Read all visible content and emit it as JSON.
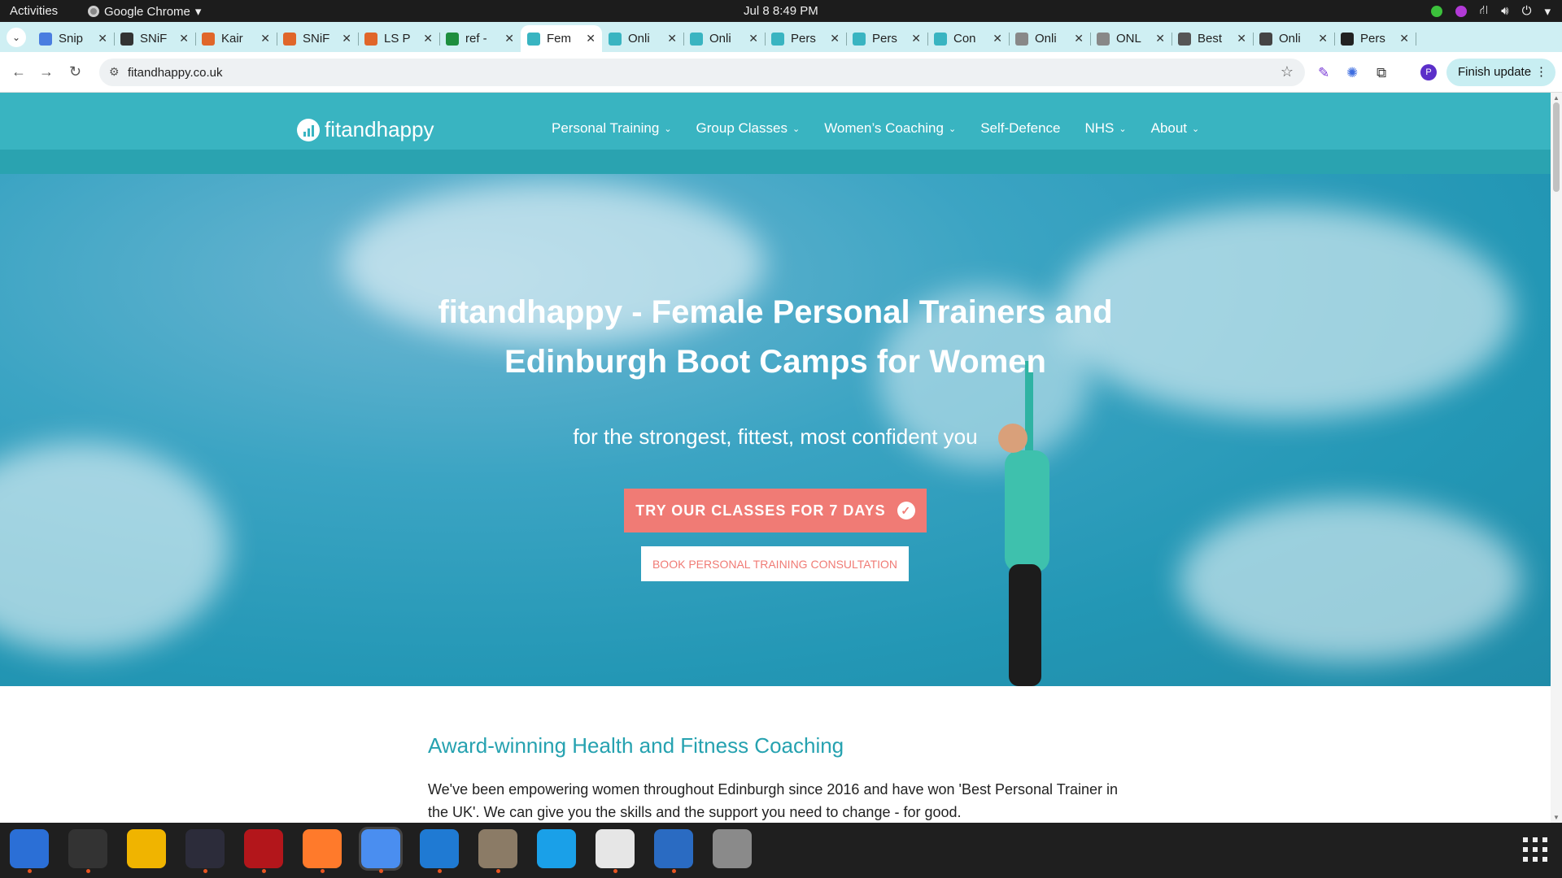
{
  "system_bar": {
    "activities": "Activities",
    "app_name": "Google Chrome",
    "clock": "Jul 8  8:49 PM"
  },
  "tabs": [
    {
      "title": "Snip",
      "color": "#4a7de0"
    },
    {
      "title": "SNiF",
      "color": "#333333"
    },
    {
      "title": "Kair",
      "color": "#e0662a"
    },
    {
      "title": "SNiF",
      "color": "#e0662a"
    },
    {
      "title": "LS P",
      "color": "#e0662a"
    },
    {
      "title": "ref -",
      "color": "#1e8e3e"
    },
    {
      "title": "Fem",
      "color": "#39b4c1"
    },
    {
      "title": "Onli",
      "color": "#39b4c1"
    },
    {
      "title": "Onli",
      "color": "#39b4c1"
    },
    {
      "title": "Pers",
      "color": "#39b4c1"
    },
    {
      "title": "Pers",
      "color": "#39b4c1"
    },
    {
      "title": "Con",
      "color": "#39b4c1"
    },
    {
      "title": "Onli",
      "color": "#888888"
    },
    {
      "title": "ONL",
      "color": "#888888"
    },
    {
      "title": "Best",
      "color": "#555555"
    },
    {
      "title": "Onli",
      "color": "#444444"
    },
    {
      "title": "Pers",
      "color": "#222222"
    }
  ],
  "browser": {
    "url": "fitandhappy.co.uk",
    "finish_update": "Finish update",
    "profile_initial": "P"
  },
  "site": {
    "logo_text": "fitandhappy",
    "nav": [
      "Personal Training",
      "Group Classes",
      "Women’s Coaching",
      "Self-Defence",
      "NHS",
      "About"
    ],
    "hero_title_line1": "fitandhappy - Female Personal Trainers and",
    "hero_title_line2": "Edinburgh Boot Camps for Women",
    "hero_subtitle": "for the strongest, fittest, most confident you",
    "cta_primary": "TRY OUR CLASSES FOR 7 DAYS",
    "cta_secondary": "BOOK PERSONAL TRAINING CONSULTATION",
    "section_title": "Award-winning Health and Fitness Coaching",
    "section_body": "We've been empowering women throughout Edinburgh since 2016 and have won 'Best Personal Trainer in the UK'. We can give you the skills and the support you need to change - for good."
  },
  "colors": {
    "brand_teal": "#39b4c1",
    "cta_coral": "#f07b75"
  },
  "dock": [
    "thunderbird-icon",
    "terminal-icon",
    "calculator-icon",
    "system-monitor-icon",
    "filezilla-icon",
    "firefox-icon",
    "chrome-icon",
    "vscode-icon",
    "files-icon",
    "skype-icon",
    "text-editor-icon",
    "writer-icon",
    "disk-icon"
  ]
}
